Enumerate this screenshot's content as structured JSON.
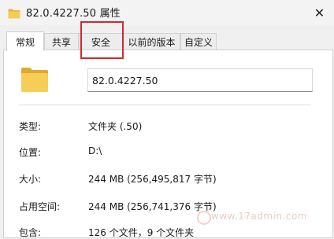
{
  "window": {
    "title": "82.0.4227.50 属性",
    "close_glyph": "✕"
  },
  "tabs": [
    {
      "label": "常规",
      "active": true
    },
    {
      "label": "共享",
      "active": false
    },
    {
      "label": "安全",
      "active": false
    },
    {
      "label": "以前的版本",
      "active": false
    },
    {
      "label": "自定义",
      "active": false
    }
  ],
  "general": {
    "folder_name": "82.0.4227.50",
    "properties": [
      {
        "label": "类型:",
        "value": "文件夹 (.50)"
      },
      {
        "label": "位置:",
        "value": "D:\\"
      },
      {
        "label": "大小:",
        "value": "244 MB (256,495,817 字节)"
      },
      {
        "label": "占用空间:",
        "value": "244 MB (256,741,376 字节)"
      },
      {
        "label": "包含:",
        "value": "126 个文件，9 个文件夹"
      }
    ]
  },
  "icons": {
    "title_icon": "folder-icon",
    "big_icon": "folder-icon",
    "folder_color": "#f0c44c"
  },
  "annotation": {
    "highlight_color": "#d9262b"
  },
  "watermark": {
    "text": "www.17admin.com"
  }
}
